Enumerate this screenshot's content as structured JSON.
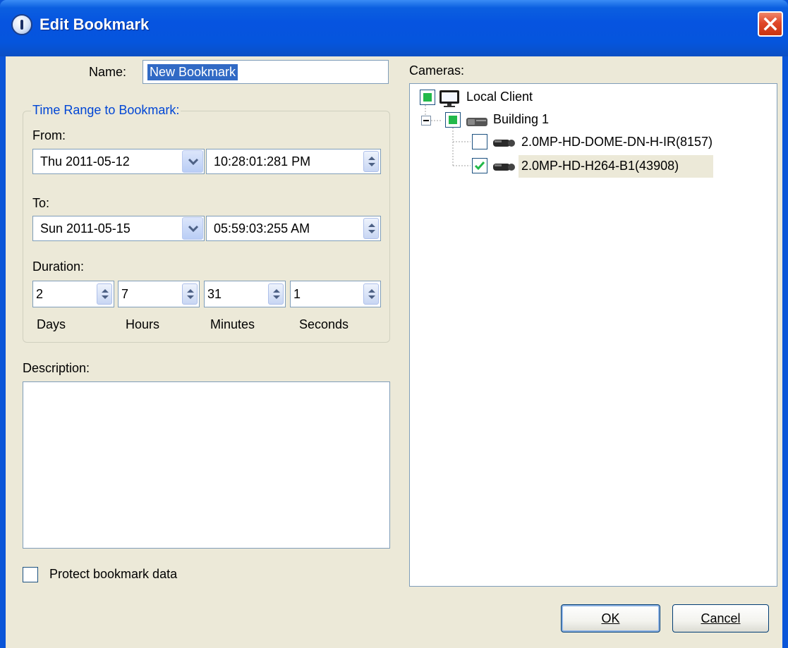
{
  "window": {
    "title": "Edit Bookmark"
  },
  "form": {
    "name_label": "Name:",
    "name_value": "New Bookmark",
    "time_range_legend": "Time Range to Bookmark:",
    "from_label": "From:",
    "from_date": "Thu 2011-05-12",
    "from_time": "10:28:01:281  PM",
    "to_label": "To:",
    "to_date": "Sun 2011-05-15",
    "to_time": "05:59:03:255  AM",
    "duration_label": "Duration:",
    "duration": {
      "days": "2",
      "hours": "7",
      "minutes": "31",
      "seconds": "1",
      "days_label": "Days",
      "hours_label": "Hours",
      "minutes_label": "Minutes",
      "seconds_label": "Seconds"
    },
    "description_label": "Description:",
    "description_value": "",
    "protect_label": "Protect bookmark data",
    "protect_checked": false
  },
  "cameras": {
    "label": "Cameras:",
    "tree": {
      "root": {
        "label": "Local Client",
        "state": "partial",
        "icon": "monitor-icon"
      },
      "site": {
        "label": "Building 1",
        "state": "partial",
        "icon": "server-icon",
        "expanded": true
      },
      "camera1": {
        "label": "2.0MP-HD-DOME-DN-H-IR(8157)",
        "checked": false,
        "icon": "camera-icon"
      },
      "camera2": {
        "label": "2.0MP-HD-H264-B1(43908)",
        "checked": true,
        "icon": "camera-icon",
        "selected": true
      }
    }
  },
  "buttons": {
    "ok_label": "OK",
    "cancel_label": "Cancel"
  },
  "colors": {
    "titlebar": "#0654e0",
    "dialog_bg": "#ece9d8",
    "selection": "#316ac5",
    "check_green": "#22b94a"
  }
}
